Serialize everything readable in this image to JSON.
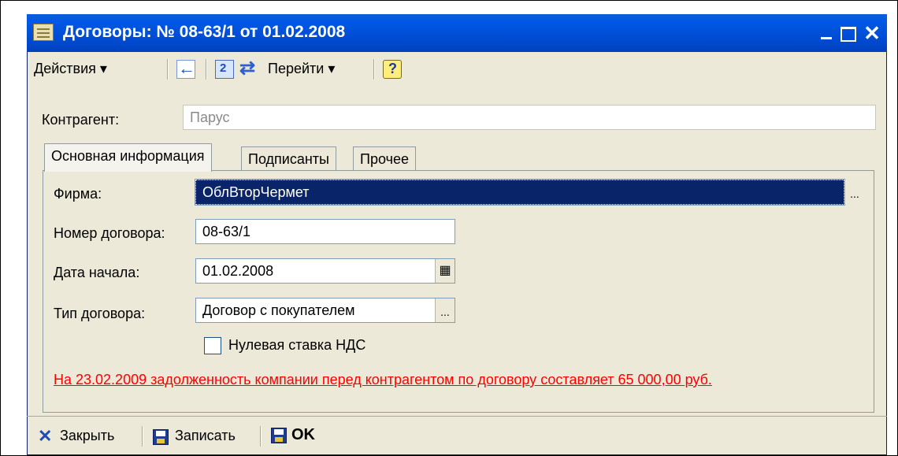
{
  "window": {
    "title": "Договоры: № 08-63/1 от 01.02.2008",
    "close_glyph": "✕"
  },
  "toolbar": {
    "actions_label": "Действия ▾",
    "goto_label": "Перейти ▾"
  },
  "form": {
    "kontragent_label": "Контрагент:",
    "kontragent_value": "Парус",
    "tabs": [
      "Основная информация",
      "Подписанты",
      "Прочее"
    ],
    "firma_label": "Фирма:",
    "firma_value": "ОблВторЧермет",
    "number_label": "Номер договора:",
    "number_value": "08-63/1",
    "start_date_label": "Дата начала:",
    "start_date_value": "01.02.2008",
    "type_label": "Тип договора:",
    "type_value": "Договор с покупателем",
    "vat_checkbox_label": "Нулевая ставка НДС",
    "vat_checkbox_checked": false,
    "select_button_glyph": "...",
    "warning_text": "На 23.02.2009 задолженность компании перед контрагентом по договору составляет 65 000,00 руб."
  },
  "bottom": {
    "close_label": "Закрыть",
    "save_label": "Записать",
    "ok_label": "OK"
  },
  "colors": {
    "titlebar": "#0058e6",
    "selection": "#0a246a",
    "warning": "#ff0000",
    "window_bg": "#ece9d8"
  }
}
